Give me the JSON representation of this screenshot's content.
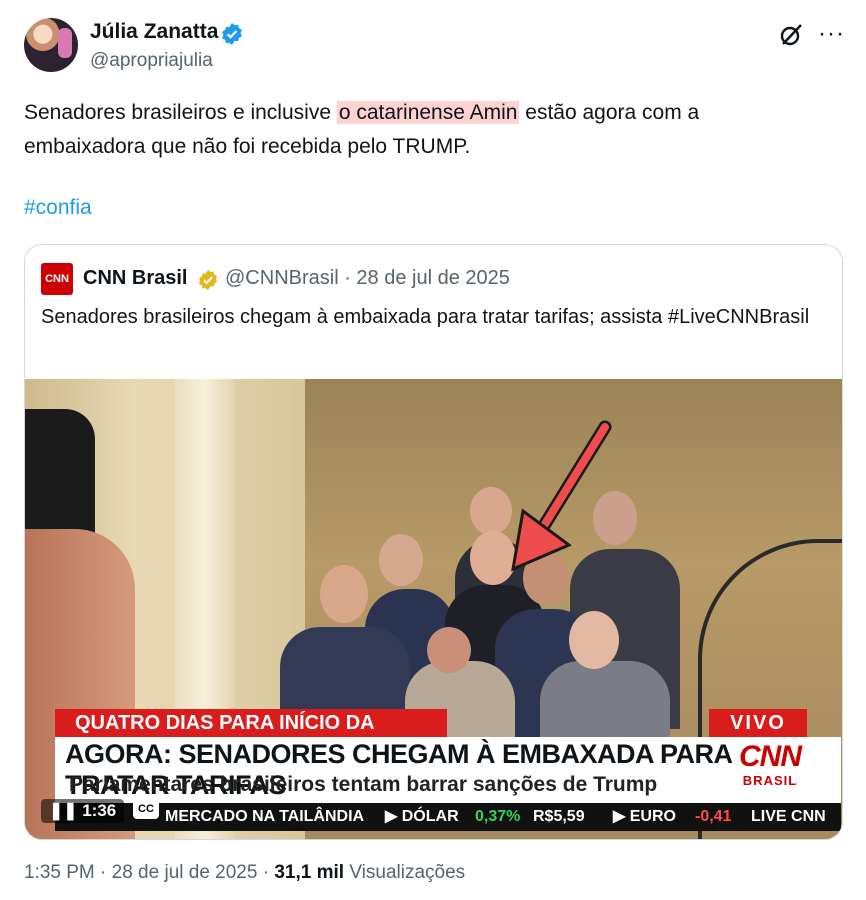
{
  "author": {
    "name": "Júlia Zanatta",
    "handle": "@apropriajulia"
  },
  "tweet": {
    "text_before": "Senadores brasileiros e inclusive ",
    "text_highlight": "o catarinense Amin",
    "text_after": " estão agora com a embaixadora que não foi recebida pelo TRUMP.",
    "hashtag": "#confia"
  },
  "quote": {
    "logo_text": "CNN",
    "name": "CNN Brasil",
    "handle_date": "@CNNBrasil · 28 de jul de 2025",
    "text": "Senadores brasileiros chegam à embaixada para tratar tarifas; assista #LiveCNNBrasil"
  },
  "video": {
    "banner_top": "QUATRO DIAS PARA INÍCIO DA TAXAÇÃO",
    "live_label": "VIVO",
    "headline": "AGORA: SENADORES CHEGAM À EMBAXADA PARA TRATAR TARIFAS",
    "subheadline": "Parlamentares brasileiros tentam barrar sanções de Trump",
    "brand_big": "CNN",
    "brand_small": "BRASIL",
    "ticker": {
      "market": "MERCADO NA TAILÂNDIA",
      "dolar_label": "▶ DÓLAR",
      "dolar_change": "0,37%",
      "dolar_value": "R$5,59",
      "euro_label": "▶ EURO",
      "euro_change": "-0,41",
      "live": "LIVE CNN"
    },
    "time": "1:36",
    "cc": "CC"
  },
  "footer": {
    "time_date": "1:35 PM · 28 de jul de 2025 · ",
    "views_count": "31,1 mil",
    "views_label": " Visualizações"
  },
  "colors": {
    "link": "#1d9bf0",
    "verified": "#1d9bf0",
    "highlight": "#ffd2d2",
    "cnn_red": "#cc0000"
  },
  "icons": [
    "verified-badge-icon",
    "grok-icon",
    "more-icon",
    "gold-badge-icon",
    "pause-icon",
    "cc-icon",
    "arrow-annotation-icon"
  ]
}
